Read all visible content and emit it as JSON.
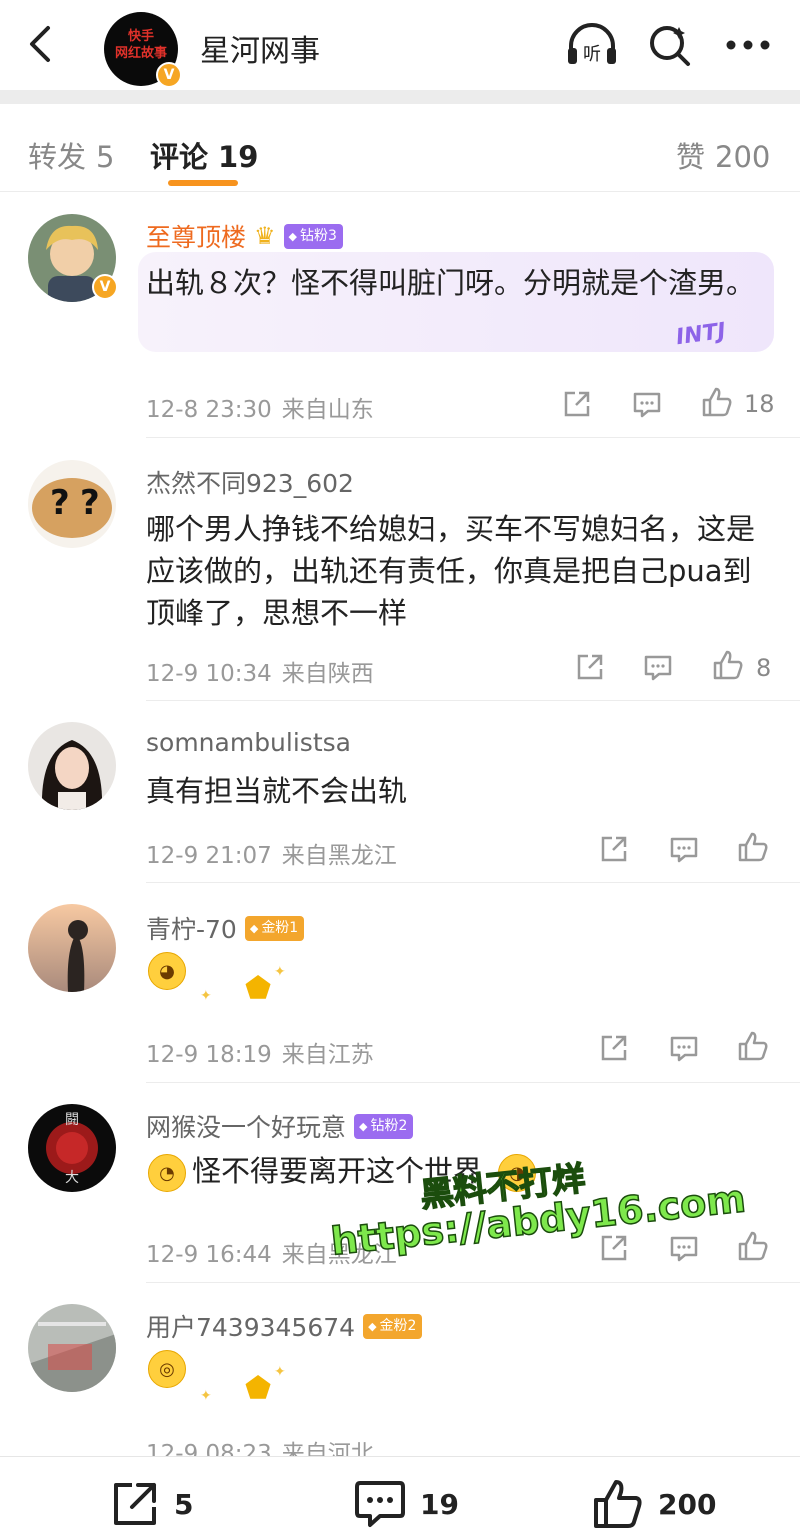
{
  "header": {
    "account_name": "星河网事",
    "avatar_logo_line1": "快手",
    "avatar_logo_line2": "网红故事",
    "verified_mark": "V",
    "listen_label": "听",
    "icons": [
      "back-icon",
      "listen-icon",
      "search-icon",
      "more-icon"
    ]
  },
  "tabs": [
    {
      "label": "转发",
      "count": "5"
    },
    {
      "label": "评论",
      "count": "19"
    },
    {
      "label": "赞",
      "count": "200"
    }
  ],
  "comments": [
    {
      "user": "至尊顶楼",
      "badge": "钻粉3",
      "text": "出轨８次？怪不得叫脏门呀。分明就是个渣男。",
      "time": "12-8 23:30",
      "location": "来自山东",
      "likes": "18",
      "tag": "INTJ"
    },
    {
      "user": "杰然不同923_602",
      "text": "哪个男人挣钱不给媳妇，买车不写媳妇名，这是应该做的，出轨还有责任，你真是把自己pua到顶峰了，思想不一样",
      "time": "12-9 10:34",
      "location": "来自陕西",
      "likes": "8"
    },
    {
      "user": "somnambulistsa",
      "text": "真有担当就不会出轨",
      "time": "12-9 21:07",
      "location": "来自黑龙江"
    },
    {
      "user": "青柠-70",
      "badge": "金粉1",
      "time": "12-9 18:19",
      "location": "来自江苏"
    },
    {
      "user": "网猴没一个好玩意",
      "badge": "钻粉2",
      "text": "怪不得要离开这个世界",
      "time": "12-9 16:44",
      "location": "来自黑龙江"
    },
    {
      "user": "用户7439345674",
      "badge": "金粉2",
      "time": "12-9 08:23",
      "location": "来自河北"
    }
  ],
  "watermark": {
    "line1": "黑料不打烊",
    "line2": "https://abdy16.com"
  },
  "bottom_bar": {
    "repost_count": "5",
    "comment_count": "19",
    "like_count": "200"
  },
  "colors": {
    "accent_orange": "#f7931e",
    "vip_name": "#ee6a1f",
    "diamond_badge": "#9b6cf0",
    "gold_badge": "#f3a62d"
  }
}
